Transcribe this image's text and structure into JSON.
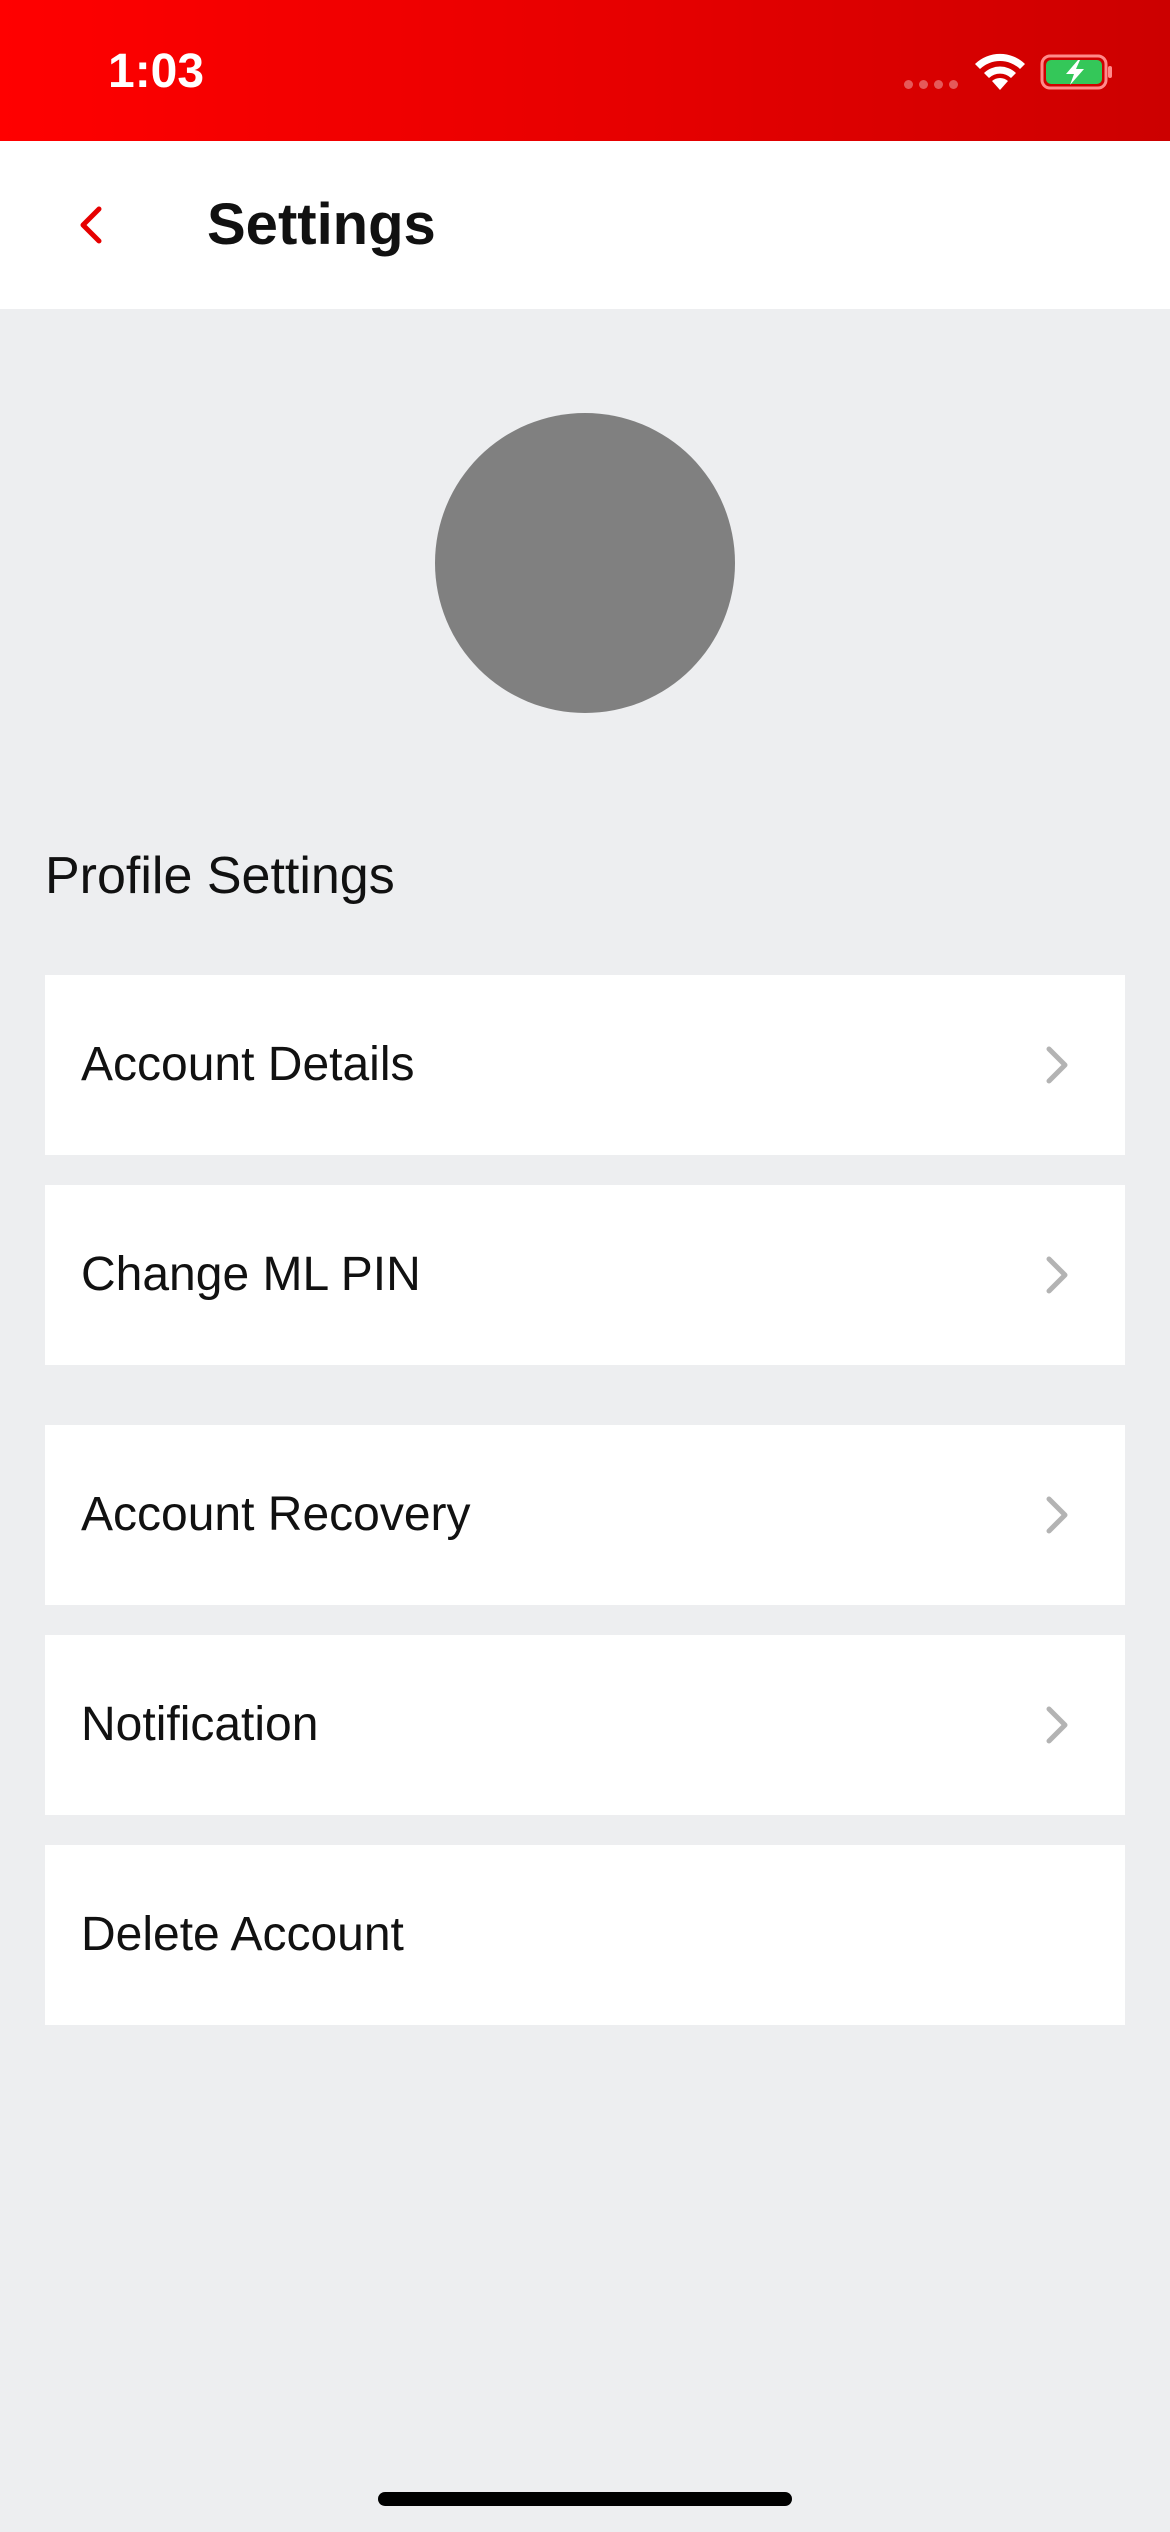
{
  "status_bar": {
    "time": "1:03",
    "icons": [
      "cellular-signal-icon",
      "wifi-icon",
      "battery-charging-icon"
    ],
    "battery_color": "#34c759"
  },
  "header": {
    "back_icon": "chevron-left-icon",
    "title": "Settings"
  },
  "profile": {
    "avatar_color": "#808080"
  },
  "profile_settings": {
    "section_title": "Profile Settings",
    "items": [
      {
        "label": "Account Details",
        "icon": "chevron-right-icon"
      },
      {
        "label": "Change ML PIN",
        "icon": "chevron-right-icon"
      },
      {
        "label": "Account Recovery",
        "icon": "chevron-right-icon"
      },
      {
        "label": "Notification",
        "icon": "chevron-right-icon"
      },
      {
        "label": "Delete Account"
      }
    ]
  },
  "colors": {
    "accent": "#e60000",
    "background": "#edeef0",
    "card": "#ffffff",
    "chevron": "#b3b3b3"
  }
}
